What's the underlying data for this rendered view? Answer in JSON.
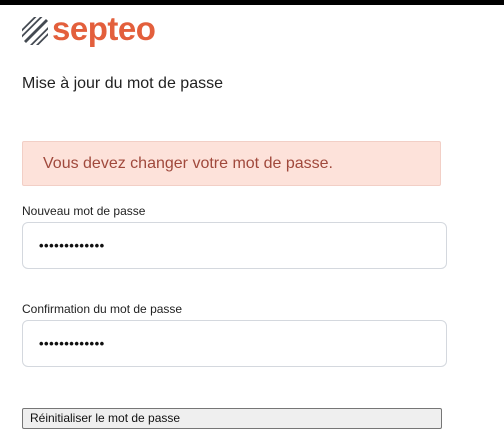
{
  "brand": {
    "name": "septeo",
    "color": "#e35f3c",
    "logo_icon": "septeo-stripes-logo-icon"
  },
  "page": {
    "title": "Mise à jour du mot de passe"
  },
  "alert": {
    "message": "Vous devez changer votre mot de passe.",
    "background": "#fde2da",
    "text_color": "#a0493c"
  },
  "form": {
    "new_password": {
      "label": "Nouveau mot de passe",
      "value": "•••••••••••••"
    },
    "confirm_password": {
      "label": "Confirmation du mot de passe",
      "value": "•••••••••••••"
    },
    "submit_label": "Réinitialiser le mot de passe"
  }
}
